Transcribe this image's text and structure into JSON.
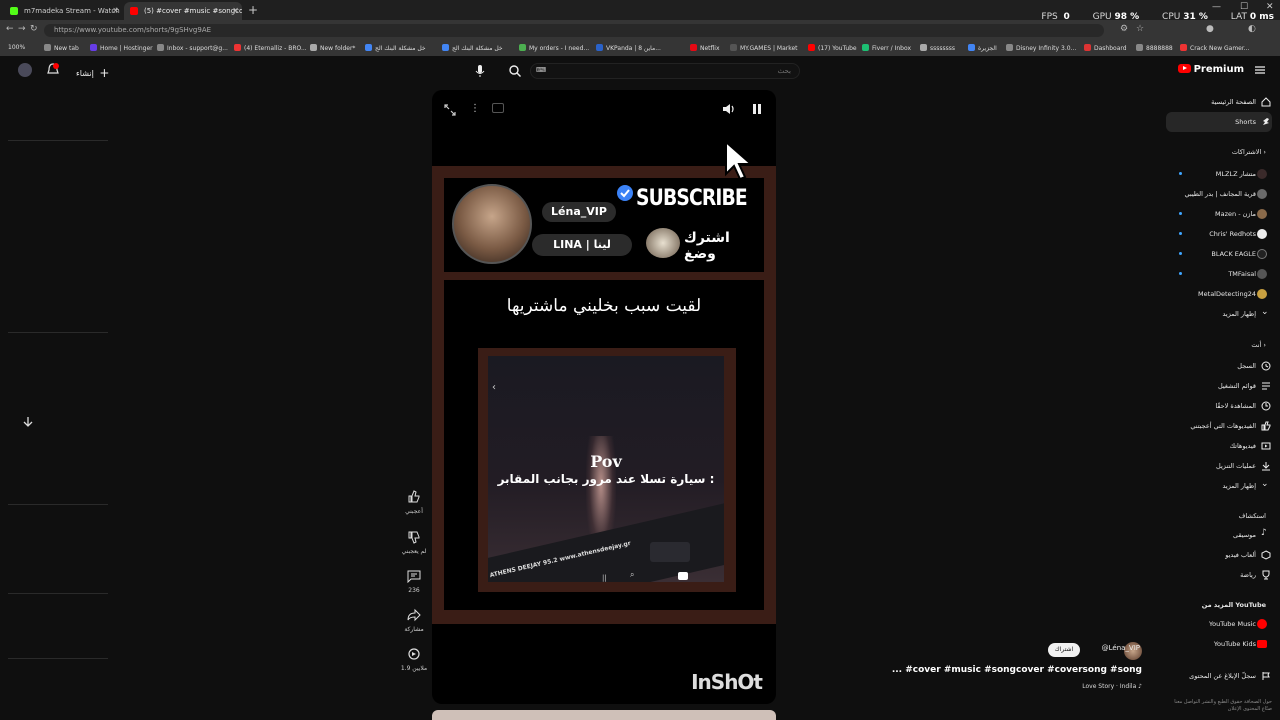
{
  "browser": {
    "tabs": [
      {
        "label": "m7madeka Stream - Watch Live o",
        "active": false
      },
      {
        "label": "(5) #cover #music #songcover",
        "active": true
      }
    ],
    "url": "https://www.youtube.com/shorts/9gSHvg9AE",
    "zoom": "100%",
    "perf": {
      "fps_label": "FPS",
      "fps": "0",
      "gpu_label": "GPU",
      "gpu": "98 %",
      "cpu_label": "CPU",
      "cpu": "31 %",
      "lat_label": "LAT",
      "lat": "0 ms"
    },
    "bookmarks": [
      "New tab",
      "Home | Hostinger",
      "Inbox - support@g...",
      "(4) Eternalliz - BRO...",
      "New folder*",
      "خل مشكلة البنك الج",
      "خل مشكلة البنك الج",
      "My orders - I need...",
      "VKPanda | 8 ماين...",
      "Netflix",
      "MY.GAMES | Market",
      "(17) YouTube",
      "Fiverr / Inbox",
      "ssssssss",
      "الجزيرة",
      "Disney Infinity 3.0...",
      "Dashboard",
      "8888888",
      "Crack New Gamer..."
    ]
  },
  "youtube": {
    "create_label": "إنشاء",
    "search_placeholder": "بحث",
    "premium_label": "Premium",
    "search_button": "⌕"
  },
  "video": {
    "banner_name": "Léna_VIP",
    "banner_name_ar": "LINA | لينا",
    "banner_subscribe": "SUBSCRIBE",
    "banner_subscribe_ar": "اشترك وضغ",
    "caption_top": "لقيت سبب بخليني ماشتريها",
    "pov": "Pov",
    "pov_text": "سيارة تسلا عند مرور بجانب المقابر :",
    "radio_text": "ATHENS DEEJAY 95.2 www.athensdeejay.gr",
    "watermark": "InShOt"
  },
  "actions": [
    {
      "label": "أعجبني",
      "icon": "like-icon"
    },
    {
      "label": "لم يعجبني",
      "icon": "dislike-icon"
    },
    {
      "label": "236",
      "icon": "comment-icon"
    },
    {
      "label": "مشاركة",
      "icon": "share-icon"
    },
    {
      "label": "1.9 ملايين",
      "icon": "remix-icon"
    }
  ],
  "sidebar": {
    "main": [
      {
        "label": "الصفحة الرئيسية",
        "icon": "home-icon"
      },
      {
        "label": "Shorts",
        "icon": "shorts-icon"
      }
    ],
    "subs_header": "الاشتراكات",
    "subs": [
      {
        "label": "MLZLZ متشار",
        "color": "#3a2a2a"
      },
      {
        "label": "قرية المجانف | بدر الطيبي",
        "color": "#6a6a6a"
      },
      {
        "label": "Mazen - مازن",
        "color": "#8a6a4a"
      },
      {
        "label": "Chris' Redhots",
        "color": "#eeeeee"
      },
      {
        "label": "BLACK EAGLE",
        "color": "#222222"
      },
      {
        "label": "TMFaisal",
        "color": "#555555"
      },
      {
        "label": "MetalDetecting24",
        "color": "#c8a040"
      }
    ],
    "show_more": "إظهار المزيد",
    "you_header": "أنت",
    "you": [
      {
        "label": "السجل",
        "icon": "history-icon"
      },
      {
        "label": "قوائم التشغيل",
        "icon": "playlist-icon"
      },
      {
        "label": "المشاهدة لاحقًا",
        "icon": "clock-icon"
      },
      {
        "label": "الفيديوهات التي أعجبتني",
        "icon": "like-icon"
      },
      {
        "label": "فيديوهاتك",
        "icon": "video-icon"
      },
      {
        "label": "عمليات التنزيل",
        "icon": "download-icon"
      },
      {
        "label": "إظهار المزيد",
        "icon": "chevron-down-icon"
      }
    ],
    "explore_header": "استكشاف",
    "explore": [
      {
        "label": "موسيقى",
        "icon": "music-icon"
      },
      {
        "label": "ألعاب فيديو",
        "icon": "gaming-icon"
      },
      {
        "label": "رياضة",
        "icon": "sports-icon"
      }
    ],
    "more_header": "المزيد من YouTube",
    "more": [
      {
        "label": "YouTube Music",
        "color": "#ff0000"
      },
      {
        "label": "YouTube Kids",
        "color": "#ff0000"
      }
    ],
    "report": "سجلّ الإبلاغ عن المحتوى",
    "footer": "حول الصحافة حقوق الطبع والنشر التواصل معنا صنّاع المحتوى الإعلان"
  },
  "meta": {
    "channel": "@Léna_VIP",
    "subscribe": "اشتراك",
    "title": "... #cover #music #songcover #coversong #song",
    "song": "Love Story · Indila ♪"
  }
}
